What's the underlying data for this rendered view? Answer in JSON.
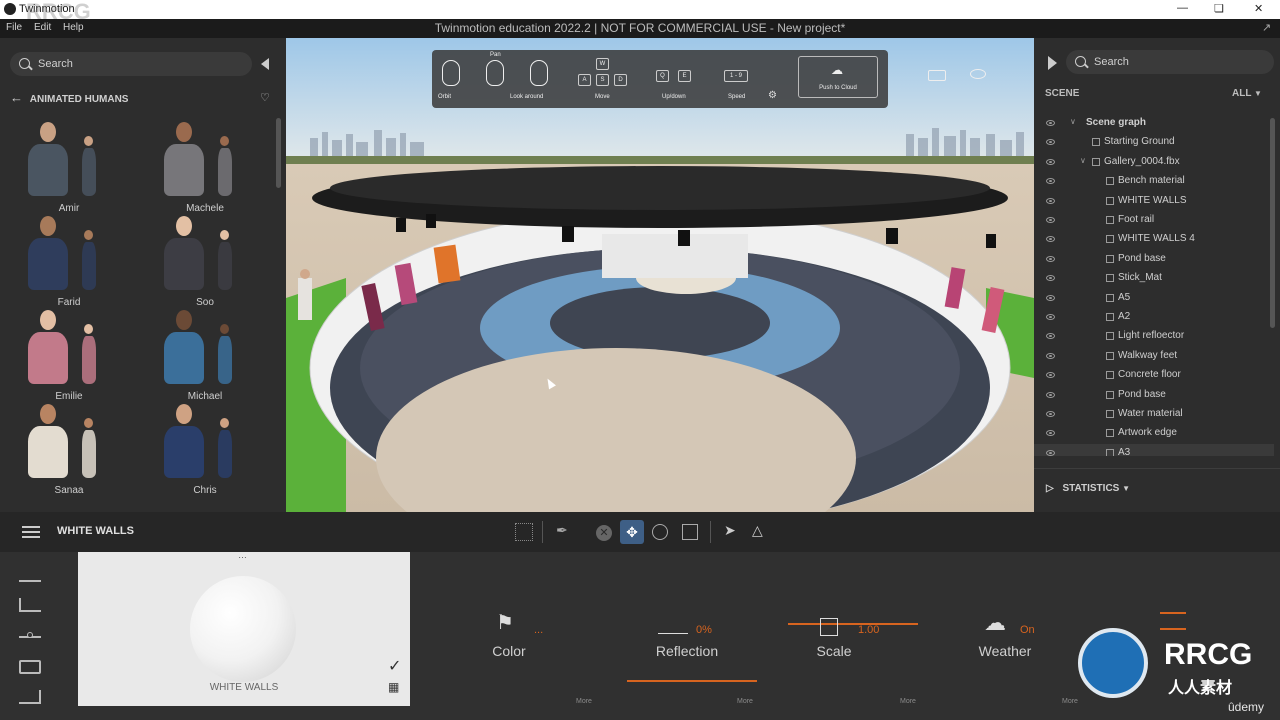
{
  "os": {
    "title": "Twinmotion",
    "watermark": "RRCG"
  },
  "app": {
    "menu": [
      "File",
      "Edit",
      "Help"
    ],
    "title": "Twinmotion education 2022.2 | NOT FOR COMMERCIAL USE - New project*"
  },
  "left": {
    "search_placeholder": "Search",
    "category": "ANIMATED HUMANS",
    "humans": [
      {
        "name": "Amir",
        "shirt": "#4a5561",
        "skin": "#c9a184"
      },
      {
        "name": "Machele",
        "shirt": "#77767a",
        "skin": "#9a6a4e"
      },
      {
        "name": "Farid",
        "shirt": "#2f3d5c",
        "skin": "#a77a5a"
      },
      {
        "name": "Soo",
        "shirt": "#3d3d44",
        "skin": "#e3c0a4"
      },
      {
        "name": "Emilie",
        "shirt": "#c27a8a",
        "skin": "#e3bfa4"
      },
      {
        "name": "Michael",
        "shirt": "#3b6f9a",
        "skin": "#6b4a36"
      },
      {
        "name": "Sanaa",
        "shirt": "#e3dcd0",
        "skin": "#b88462"
      },
      {
        "name": "Chris",
        "shirt": "#2a3e6a",
        "skin": "#cfa283"
      }
    ]
  },
  "toolbar": {
    "pan": "Pan",
    "orbit": "Orbit",
    "look_around": "Look around",
    "move": "Move",
    "up_down": "Up/down",
    "speed": "Speed",
    "speed_keys": "1 - 9",
    "keys_move": [
      "W",
      "A",
      "S",
      "D"
    ],
    "keys_updown": [
      "Q",
      "E"
    ],
    "push_to_cloud": "Push to Cloud"
  },
  "right": {
    "search_placeholder": "Search",
    "scene_label": "SCENE",
    "filter": "ALL",
    "tree": [
      {
        "label": "Scene graph",
        "level": 0,
        "bold": true
      },
      {
        "label": "Starting Ground",
        "level": 1
      },
      {
        "label": "Gallery_0004.fbx",
        "level": 1
      },
      {
        "label": "Bench material",
        "level": 2
      },
      {
        "label": "WHITE WALLS",
        "level": 2
      },
      {
        "label": "Foot rail",
        "level": 2
      },
      {
        "label": "WHITE WALLS 4",
        "level": 2
      },
      {
        "label": "Pond base",
        "level": 2
      },
      {
        "label": "Stick_Mat",
        "level": 2
      },
      {
        "label": "A5",
        "level": 2
      },
      {
        "label": "A2",
        "level": 2
      },
      {
        "label": "Light refloector",
        "level": 2
      },
      {
        "label": "Walkway feet",
        "level": 2
      },
      {
        "label": "Concrete floor",
        "level": 2
      },
      {
        "label": "Pond base",
        "level": 2
      },
      {
        "label": "Water material",
        "level": 2
      },
      {
        "label": "Artwork edge",
        "level": 2
      },
      {
        "label": "A3",
        "level": 2
      }
    ],
    "statistics": "STATISTICS"
  },
  "mid": {
    "selection": "WHITE WALLS"
  },
  "bottom": {
    "material_name": "WHITE WALLS",
    "props": [
      {
        "label": "Color",
        "value": "...",
        "more": ""
      },
      {
        "label": "Reflection",
        "value": "0%",
        "more": "More"
      },
      {
        "label": "Scale",
        "value": "1.00",
        "more": "More"
      },
      {
        "label": "Weather",
        "value": "On",
        "more": "More"
      }
    ],
    "first_more": "More",
    "brand": "RRCG",
    "brand_sub": "人人素材",
    "udemy": "ûdemy",
    "accent": "#d7641f"
  }
}
